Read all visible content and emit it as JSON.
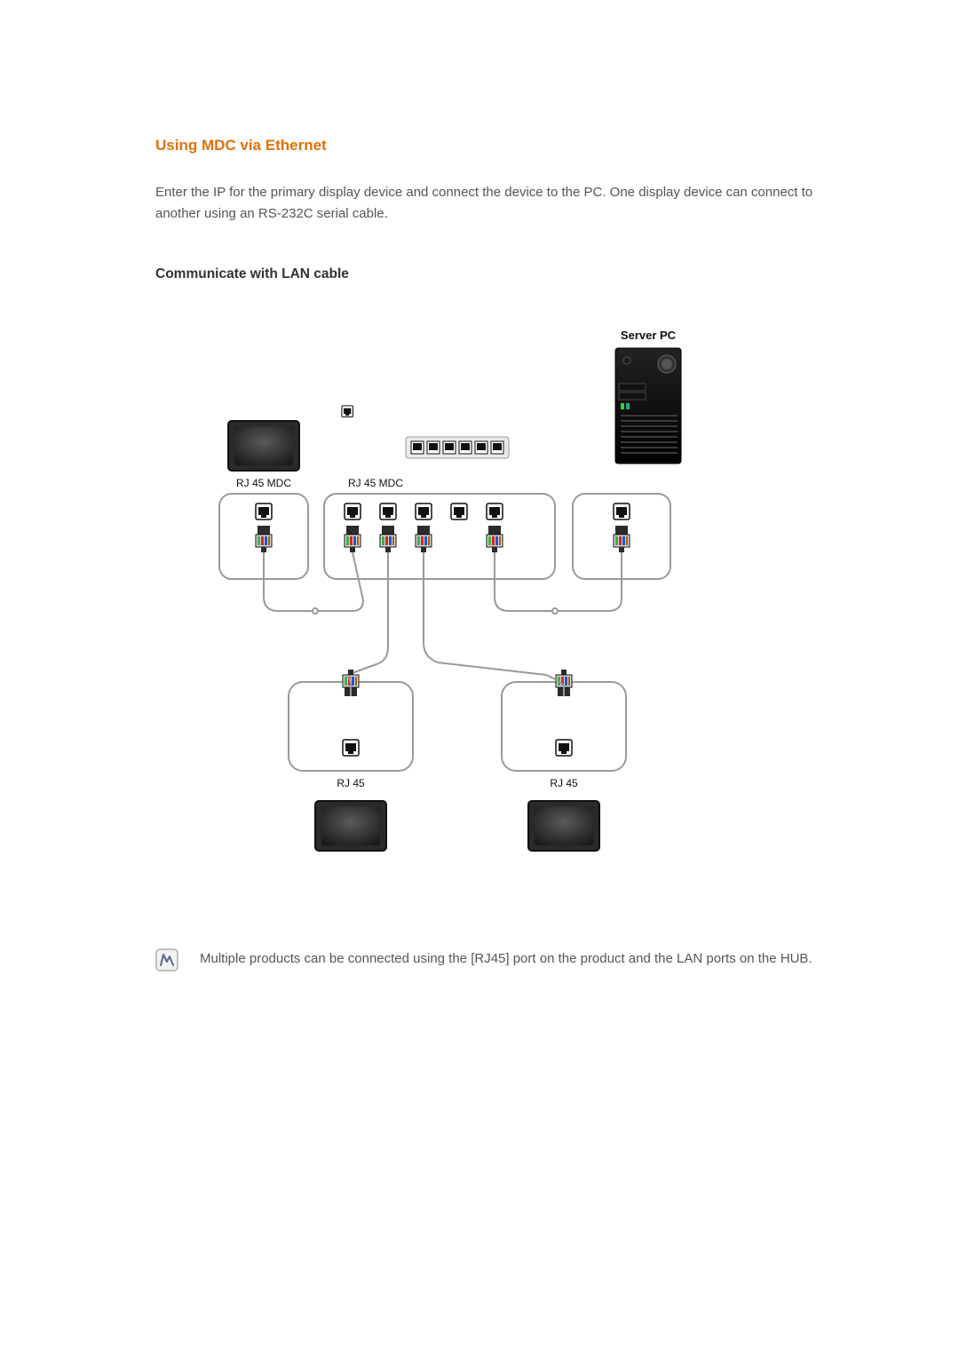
{
  "section": {
    "title": "Using MDC via Ethernet",
    "intro": "Enter the IP for the primary display device and connect the device to the PC. One display device can connect to another using an RS-232C serial cable.",
    "subtitle": "Communicate with LAN cable"
  },
  "diagram": {
    "server_label": "Server PC",
    "rj45_mdc_left": "RJ 45 MDC",
    "rj45_mdc_mid": "RJ 45 MDC",
    "rj45_bottom_left": "RJ 45",
    "rj45_bottom_right": "RJ 45"
  },
  "note": {
    "text": "Multiple products can be connected using the [RJ45] port on the product and the LAN ports on the HUB."
  }
}
